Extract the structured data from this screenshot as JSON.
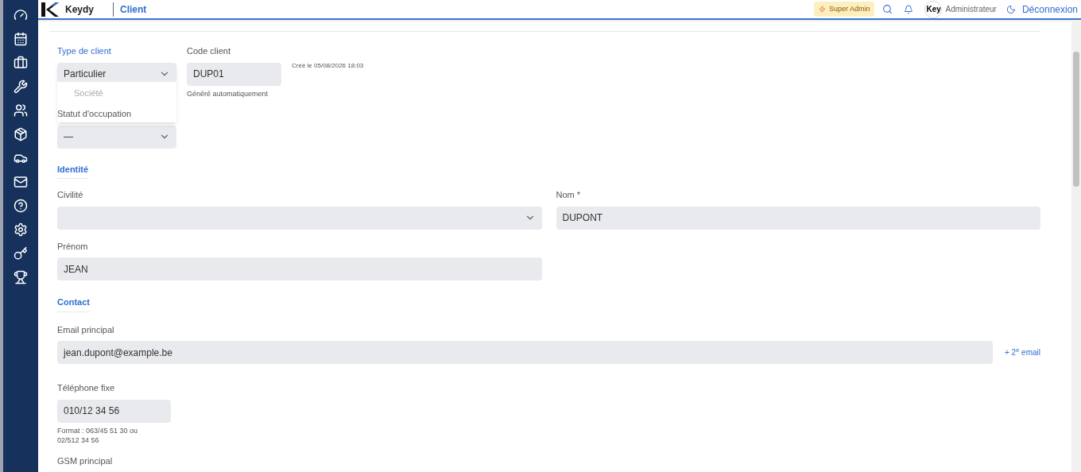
{
  "header": {
    "logo_text": "Keydy",
    "page_title": "Client",
    "role_badge": "Super Admin",
    "avatar_text": "Key",
    "user": "Administrateur",
    "logout": "Déconnexion"
  },
  "client_type": {
    "label": "Type de client",
    "value": "Particulier",
    "expanded": true,
    "options": [
      "Société"
    ]
  },
  "client_code": {
    "label": "Code client",
    "value": "DUP01",
    "hint": "Généré automatiquement",
    "created": "Créé le 05/08/2026 18:03"
  },
  "occupancy": {
    "label": "Statut d'occupation",
    "value": "—"
  },
  "identity": {
    "title": "Identité",
    "civility": {
      "label": "Civilité"
    },
    "last_name": {
      "label": "Nom *",
      "value": "DUPONT"
    },
    "first_name": {
      "label": "Prénom",
      "value": "JEAN"
    }
  },
  "contact": {
    "title": "Contact",
    "email": {
      "label": "Email principal",
      "value": "jean.dupont@example.be",
      "add_link": "+ 2$^{e}$ email"
    },
    "phone": {
      "label": "Téléphone fixe",
      "value": "010/12 34 56",
      "hint": "Format : 063/45 51 30 ou 02/512 34 56"
    },
    "mobile": {
      "label": "GSM principal"
    }
  }
}
